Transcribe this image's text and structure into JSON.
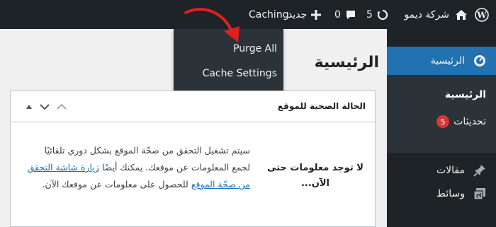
{
  "adminbar": {
    "site_name": "شركة ديمو",
    "updates_count": "5",
    "comments_count": "0",
    "new_label": "جديد",
    "caching_label": "Caching"
  },
  "caching_menu": {
    "items": [
      {
        "label": "Purge All"
      },
      {
        "label": "Cache Settings"
      }
    ]
  },
  "sidebar": {
    "dashboard_label": "الرئيسية",
    "submenu": [
      {
        "label": "الرئيسية"
      },
      {
        "label": "تحديثات",
        "badge": "5"
      }
    ],
    "items": [
      {
        "label": "مقالات"
      },
      {
        "label": "وسائط"
      }
    ]
  },
  "main": {
    "page_title": "الرئيسية",
    "widget": {
      "title": "الحالة الصحية للموقع",
      "no_info": "لا توجد معلومات حتى الآن...",
      "desc_part1": "سيتم تشغيل التحقق من صحّة الموقع بشكل دوري تلقائيًا لجمع المعلومات عن موقعك. يمكنك أيضًا",
      "desc_link": "زيارة شاشة التحقق من صحّة الموقع",
      "desc_part2": "للحصول على معلومات عن موقعك الآن."
    }
  },
  "colors": {
    "adminbar_bg": "#1d2327",
    "sidebar_bg": "#1d2327",
    "submenu_bg": "#2c3338",
    "accent": "#2271b1",
    "badge_bg": "#d63638",
    "annotation": "#e0201f"
  }
}
